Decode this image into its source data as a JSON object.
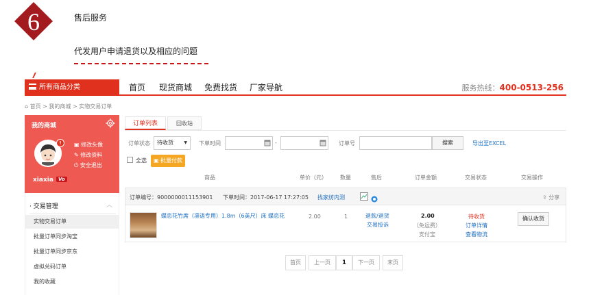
{
  "step": {
    "number": "6",
    "title": "售后服务",
    "description": "代发用户申请退货以及相应的问题",
    "badge_color": "#a31b1f"
  },
  "nav": {
    "all_categories": "所有商品分类",
    "links": [
      "首页",
      "现货商城",
      "免费找货",
      "厂家导航"
    ],
    "hotline_label": "服务热线：",
    "hotline_number": "400-0513-256",
    "accent": "#e0301e"
  },
  "breadcrumb": {
    "home": "首页",
    "sep1": " > ",
    "mall": "我的商城",
    "sep2": " > ",
    "current": "实物交易订单"
  },
  "sidebar": {
    "title": "我的商城",
    "avatar_badge": "!",
    "links": [
      "修改头像",
      "修改资料",
      "安全退出"
    ],
    "username": "xiaxia",
    "vip": "Vo",
    "section_title": "· 交易管理",
    "section_caret": "︿",
    "items": [
      "实物交易订单",
      "批量订单同步淘宝",
      "批量订单同步京东",
      "虚拟兑码订单",
      "我的收藏"
    ]
  },
  "tabs": [
    "订单列表",
    "回收站"
  ],
  "filters": {
    "status_label": "订单状态",
    "status_value": "待收货",
    "time_label": "下单时间",
    "time_sep": "-",
    "order_no_label": "订单号",
    "search": "搜索",
    "export": "导出至EXCEL"
  },
  "bulk": {
    "select_all": "全选",
    "batch_pay": "批量付款"
  },
  "table_headers": [
    "商品",
    "单价（元）",
    "数量",
    "售后",
    "订单金额",
    "交易状态",
    "交易操作"
  ],
  "order": {
    "order_no": "订单编号：9000000011153901",
    "order_time": "下单时间：2017-06-17 17:27:05",
    "seller": "找家纺内测",
    "share": "分享",
    "product_name": "蝶恋花竹席（凛语专用）1.8m（6英尺）床 蝶恋花",
    "unit_price": "2.00",
    "quantity": "1",
    "after_sale_refund": "退款/退货",
    "after_sale_complaint": "交易投诉",
    "amount": "2.00",
    "shipping": "（免运费）",
    "payment": "支付宝",
    "status": "待收货",
    "order_detail": "订单详情",
    "logistics": "查看物流",
    "confirm": "确认收货"
  },
  "pagination": [
    "首页",
    "上一页",
    "1",
    "下一页",
    "末页"
  ]
}
